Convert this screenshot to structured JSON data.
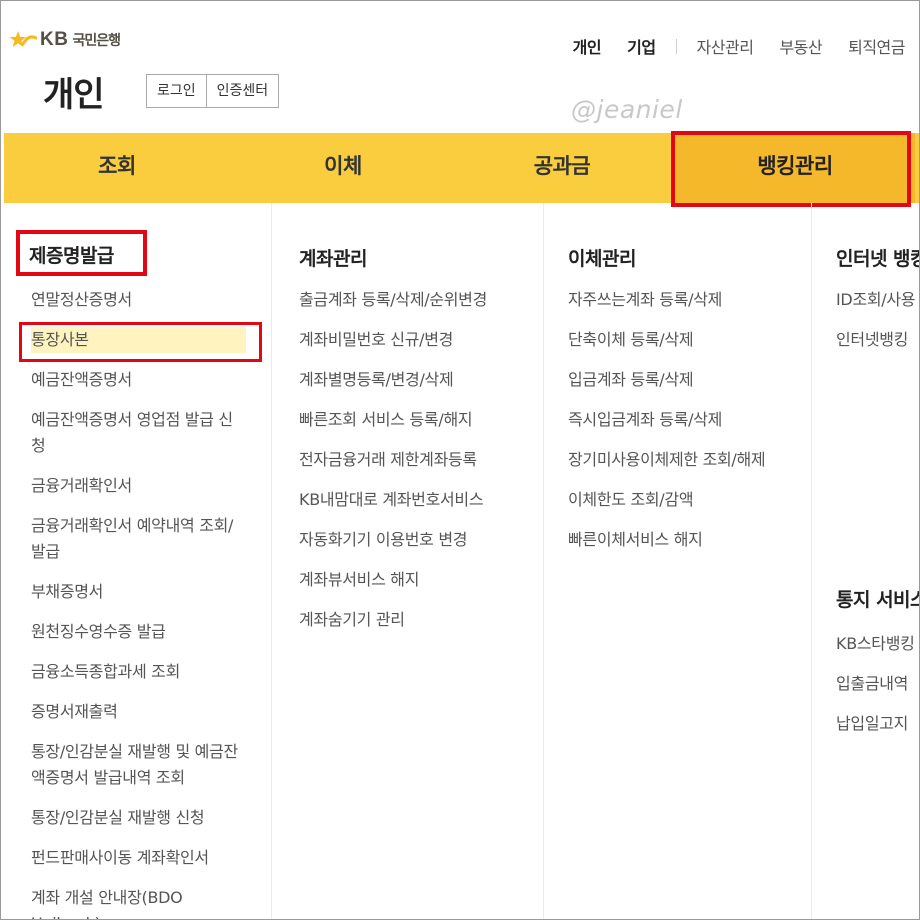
{
  "brand": {
    "star_color": "#f9b81b",
    "kb": "KB",
    "name": "국민은행"
  },
  "utility_nav": [
    "개인",
    "기업",
    "자산관리",
    "부동산",
    "퇴직연금"
  ],
  "page": {
    "title": "개인",
    "login": "로그인",
    "cert_center": "인증센터"
  },
  "watermark": "@jeaniel",
  "main_menu": {
    "tabs": [
      "조회",
      "이체",
      "공과금",
      "뱅킹관리"
    ],
    "active": "뱅킹관리",
    "bar_color": "#f9cd3d",
    "active_color": "#f5b82b",
    "highlight_color": "#e30613"
  },
  "submenu": {
    "col1": {
      "heading": "제증명발급",
      "items": [
        "연말정산증명서",
        "통장사본",
        "예금잔액증명서",
        "예금잔액증명서 영업점 발급 신청",
        "금융거래확인서",
        "금융거래확인서 예약내역 조회/발급",
        "부채증명서",
        "원천징수영수증 발급",
        "금융소득종합과세 조회",
        "증명서재출력",
        "통장/인감분실 재발행 및 예금잔액증명서 발급내역 조회",
        "통장/인감분실 재발행 신청",
        "펀드판매사이동 계좌확인서",
        "계좌 개설 안내장(BDO Unibank)"
      ],
      "selected": "통장사본"
    },
    "col2": {
      "heading": "계좌관리",
      "items": [
        "출금계좌 등록/삭제/순위변경",
        "계좌비밀번호 신규/변경",
        "계좌별명등록/변경/삭제",
        "빠른조회 서비스 등록/해지",
        "전자금융거래 제한계좌등록",
        "KB내맘대로 계좌번호서비스",
        "자동화기기 이용번호 변경",
        "계좌뷰서비스 해지",
        "계좌숨기기 관리"
      ]
    },
    "col3": {
      "heading": "이체관리",
      "items": [
        "자주쓰는계좌 등록/삭제",
        "단축이체 등록/삭제",
        "입금계좌 등록/삭제",
        "즉시입금계좌 등록/삭제",
        "장기미사용이체제한 조회/해제",
        "이체한도 조회/감액",
        "빠른이체서비스 해지"
      ]
    },
    "col4": {
      "heading": "인터넷 뱅킹",
      "items": [
        "ID조회/사용",
        "인터넷뱅킹"
      ],
      "heading2": "통지 서비스",
      "items2": [
        "KB스타뱅킹",
        "입출금내역",
        "납입일고지"
      ]
    }
  }
}
